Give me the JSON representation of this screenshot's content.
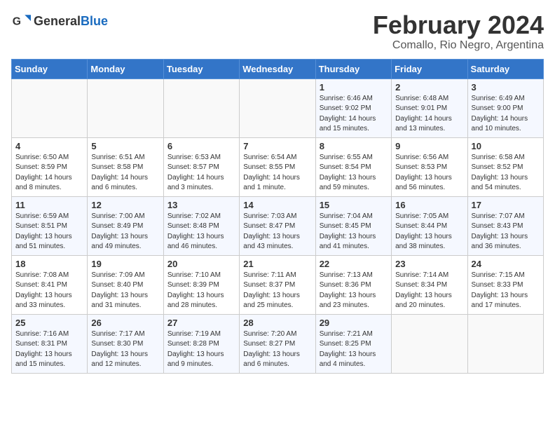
{
  "header": {
    "logo_general": "General",
    "logo_blue": "Blue",
    "month_year": "February 2024",
    "location": "Comallo, Rio Negro, Argentina"
  },
  "weekdays": [
    "Sunday",
    "Monday",
    "Tuesday",
    "Wednesday",
    "Thursday",
    "Friday",
    "Saturday"
  ],
  "weeks": [
    [
      {
        "day": "",
        "info": ""
      },
      {
        "day": "",
        "info": ""
      },
      {
        "day": "",
        "info": ""
      },
      {
        "day": "",
        "info": ""
      },
      {
        "day": "1",
        "info": "Sunrise: 6:46 AM\nSunset: 9:02 PM\nDaylight: 14 hours\nand 15 minutes."
      },
      {
        "day": "2",
        "info": "Sunrise: 6:48 AM\nSunset: 9:01 PM\nDaylight: 14 hours\nand 13 minutes."
      },
      {
        "day": "3",
        "info": "Sunrise: 6:49 AM\nSunset: 9:00 PM\nDaylight: 14 hours\nand 10 minutes."
      }
    ],
    [
      {
        "day": "4",
        "info": "Sunrise: 6:50 AM\nSunset: 8:59 PM\nDaylight: 14 hours\nand 8 minutes."
      },
      {
        "day": "5",
        "info": "Sunrise: 6:51 AM\nSunset: 8:58 PM\nDaylight: 14 hours\nand 6 minutes."
      },
      {
        "day": "6",
        "info": "Sunrise: 6:53 AM\nSunset: 8:57 PM\nDaylight: 14 hours\nand 3 minutes."
      },
      {
        "day": "7",
        "info": "Sunrise: 6:54 AM\nSunset: 8:55 PM\nDaylight: 14 hours\nand 1 minute."
      },
      {
        "day": "8",
        "info": "Sunrise: 6:55 AM\nSunset: 8:54 PM\nDaylight: 13 hours\nand 59 minutes."
      },
      {
        "day": "9",
        "info": "Sunrise: 6:56 AM\nSunset: 8:53 PM\nDaylight: 13 hours\nand 56 minutes."
      },
      {
        "day": "10",
        "info": "Sunrise: 6:58 AM\nSunset: 8:52 PM\nDaylight: 13 hours\nand 54 minutes."
      }
    ],
    [
      {
        "day": "11",
        "info": "Sunrise: 6:59 AM\nSunset: 8:51 PM\nDaylight: 13 hours\nand 51 minutes."
      },
      {
        "day": "12",
        "info": "Sunrise: 7:00 AM\nSunset: 8:49 PM\nDaylight: 13 hours\nand 49 minutes."
      },
      {
        "day": "13",
        "info": "Sunrise: 7:02 AM\nSunset: 8:48 PM\nDaylight: 13 hours\nand 46 minutes."
      },
      {
        "day": "14",
        "info": "Sunrise: 7:03 AM\nSunset: 8:47 PM\nDaylight: 13 hours\nand 43 minutes."
      },
      {
        "day": "15",
        "info": "Sunrise: 7:04 AM\nSunset: 8:45 PM\nDaylight: 13 hours\nand 41 minutes."
      },
      {
        "day": "16",
        "info": "Sunrise: 7:05 AM\nSunset: 8:44 PM\nDaylight: 13 hours\nand 38 minutes."
      },
      {
        "day": "17",
        "info": "Sunrise: 7:07 AM\nSunset: 8:43 PM\nDaylight: 13 hours\nand 36 minutes."
      }
    ],
    [
      {
        "day": "18",
        "info": "Sunrise: 7:08 AM\nSunset: 8:41 PM\nDaylight: 13 hours\nand 33 minutes."
      },
      {
        "day": "19",
        "info": "Sunrise: 7:09 AM\nSunset: 8:40 PM\nDaylight: 13 hours\nand 31 minutes."
      },
      {
        "day": "20",
        "info": "Sunrise: 7:10 AM\nSunset: 8:39 PM\nDaylight: 13 hours\nand 28 minutes."
      },
      {
        "day": "21",
        "info": "Sunrise: 7:11 AM\nSunset: 8:37 PM\nDaylight: 13 hours\nand 25 minutes."
      },
      {
        "day": "22",
        "info": "Sunrise: 7:13 AM\nSunset: 8:36 PM\nDaylight: 13 hours\nand 23 minutes."
      },
      {
        "day": "23",
        "info": "Sunrise: 7:14 AM\nSunset: 8:34 PM\nDaylight: 13 hours\nand 20 minutes."
      },
      {
        "day": "24",
        "info": "Sunrise: 7:15 AM\nSunset: 8:33 PM\nDaylight: 13 hours\nand 17 minutes."
      }
    ],
    [
      {
        "day": "25",
        "info": "Sunrise: 7:16 AM\nSunset: 8:31 PM\nDaylight: 13 hours\nand 15 minutes."
      },
      {
        "day": "26",
        "info": "Sunrise: 7:17 AM\nSunset: 8:30 PM\nDaylight: 13 hours\nand 12 minutes."
      },
      {
        "day": "27",
        "info": "Sunrise: 7:19 AM\nSunset: 8:28 PM\nDaylight: 13 hours\nand 9 minutes."
      },
      {
        "day": "28",
        "info": "Sunrise: 7:20 AM\nSunset: 8:27 PM\nDaylight: 13 hours\nand 6 minutes."
      },
      {
        "day": "29",
        "info": "Sunrise: 7:21 AM\nSunset: 8:25 PM\nDaylight: 13 hours\nand 4 minutes."
      },
      {
        "day": "",
        "info": ""
      },
      {
        "day": "",
        "info": ""
      }
    ]
  ]
}
